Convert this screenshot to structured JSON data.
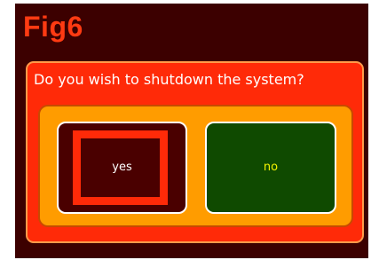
{
  "figure": {
    "label": "Fig6"
  },
  "dialog": {
    "question": "Do you wish to shutdown the system?",
    "buttons": [
      {
        "label": "yes",
        "focused": true
      },
      {
        "label": "no",
        "focused": false
      }
    ]
  },
  "colors": {
    "background": "#3c0000",
    "figure_label": "#ff3a12",
    "dialog_fill": "#ff2a08",
    "dialog_border": "#ff9a4a",
    "choices_panel": "#ff9c00",
    "yes_button": "#4a0000",
    "no_button": "#0f4a00",
    "yes_text": "#ffffff",
    "no_text": "#f2f200",
    "focus_ring": "#ff2a08"
  }
}
